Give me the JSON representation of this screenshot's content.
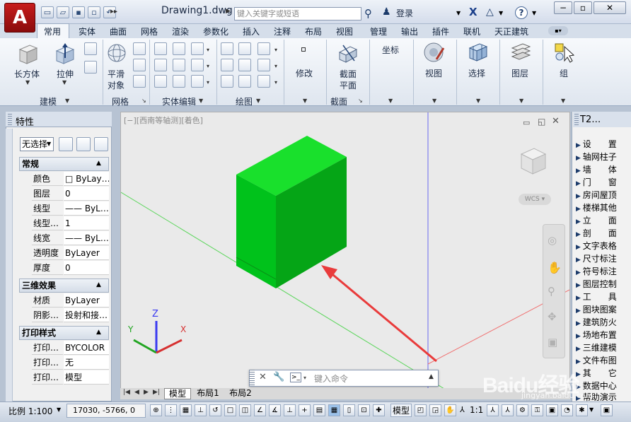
{
  "window": {
    "title": "Drawing1.dwg",
    "search_placeholder": "键入关键字或短语",
    "login": "登录"
  },
  "tabs": [
    "常用",
    "实体",
    "曲面",
    "网格",
    "渲染",
    "参数化",
    "插入",
    "注释",
    "布局",
    "视图",
    "管理",
    "输出",
    "插件",
    "联机",
    "天正建筑"
  ],
  "active_tab": "常用",
  "ribbon": {
    "box_label": "长方体",
    "extrude_label": "拉伸",
    "smooth_label_1": "平滑",
    "smooth_label_2": "对象",
    "modify_label": "修改",
    "section_label_1": "截面",
    "section_label_2": "平面",
    "coord_label": "坐标",
    "view_label": "视图",
    "select_label": "选择",
    "layers_label": "图层",
    "group_label": "组",
    "panels": {
      "modeling": "建模",
      "mesh": "网格",
      "solid_edit": "实体编辑",
      "draw": "绘图",
      "section": "截面"
    }
  },
  "properties": {
    "title": "特性",
    "selection": "无选择",
    "general_title": "常规",
    "general_rows": [
      {
        "k": "颜色",
        "v": "□ ByLay…"
      },
      {
        "k": "图层",
        "v": "0"
      },
      {
        "k": "线型",
        "v": "—— ByL…"
      },
      {
        "k": "线型…",
        "v": "1"
      },
      {
        "k": "线宽",
        "v": "—— ByL…"
      },
      {
        "k": "透明度",
        "v": "ByLayer"
      },
      {
        "k": "厚度",
        "v": "0"
      }
    ],
    "effects_title": "三维效果",
    "effects_rows": [
      {
        "k": "材质",
        "v": "ByLayer"
      },
      {
        "k": "阴影…",
        "v": "投射和接…"
      }
    ],
    "plot_title": "打印样式",
    "plot_rows": [
      {
        "k": "打印…",
        "v": "BYCOLOR"
      },
      {
        "k": "打印…",
        "v": "无"
      },
      {
        "k": "打印…",
        "v": "模型"
      }
    ]
  },
  "viewport": {
    "label": "[−][西南等轴测][着色]",
    "wcs": "WCS",
    "axis_x": "X",
    "axis_y": "Y",
    "axis_z": "Z"
  },
  "command": {
    "placeholder": "键入命令"
  },
  "layout_tabs": [
    "模型",
    "布局1",
    "布局2"
  ],
  "t2": {
    "title": "T2…",
    "items": [
      "设　　置",
      "轴网柱子",
      "墙　　体",
      "门　　窗",
      "房间屋顶",
      "楼梯其他",
      "立　　面",
      "剖　　面",
      "文字表格",
      "尺寸标注",
      "符号标注",
      "图层控制",
      "工　　具",
      "图块图案",
      "建筑防火",
      "场地布置",
      "三维建模",
      "文件布图",
      "其　　它",
      "数据中心",
      "帮助演示"
    ]
  },
  "status": {
    "scale": "比例 1:100",
    "coords": "17030, -5766, 0",
    "model": "模型",
    "anno_scale": "1:1"
  },
  "watermark": "Baidu经验",
  "watermark_url": "jingyan.baidu.com",
  "colors": {
    "box_front": "#00c21b",
    "box_top": "#19e02c",
    "box_side": "#05a516",
    "arrow": "#e93b3b",
    "app_red": "#b01515"
  }
}
